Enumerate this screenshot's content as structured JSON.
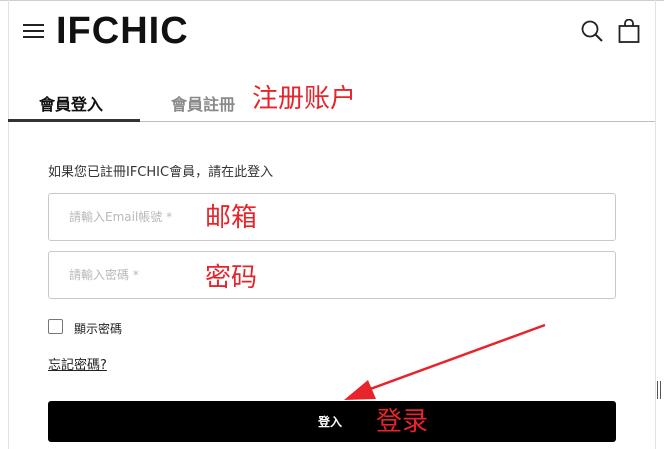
{
  "header": {
    "logo": "IFCHIC",
    "menu_icon": "hamburger-menu-icon",
    "search_icon": "search-icon",
    "bag_icon": "shopping-bag-icon"
  },
  "tabs": {
    "login": "會員登入",
    "register": "會員註冊"
  },
  "annotations": {
    "register": "注册账户",
    "email": "邮箱",
    "password": "密码",
    "login": "登录",
    "color": "#e8242b"
  },
  "form": {
    "intro": "如果您已註冊IFCHIC會員，請在此登入",
    "email_placeholder": "請輸入Email帳號 *",
    "email_value": "",
    "password_placeholder": "請輸入密碼 *",
    "password_value": "",
    "show_password_label": "顯示密碼",
    "show_password_checked": false,
    "forgot_password": "忘記密碼?",
    "login_button": "登入"
  }
}
